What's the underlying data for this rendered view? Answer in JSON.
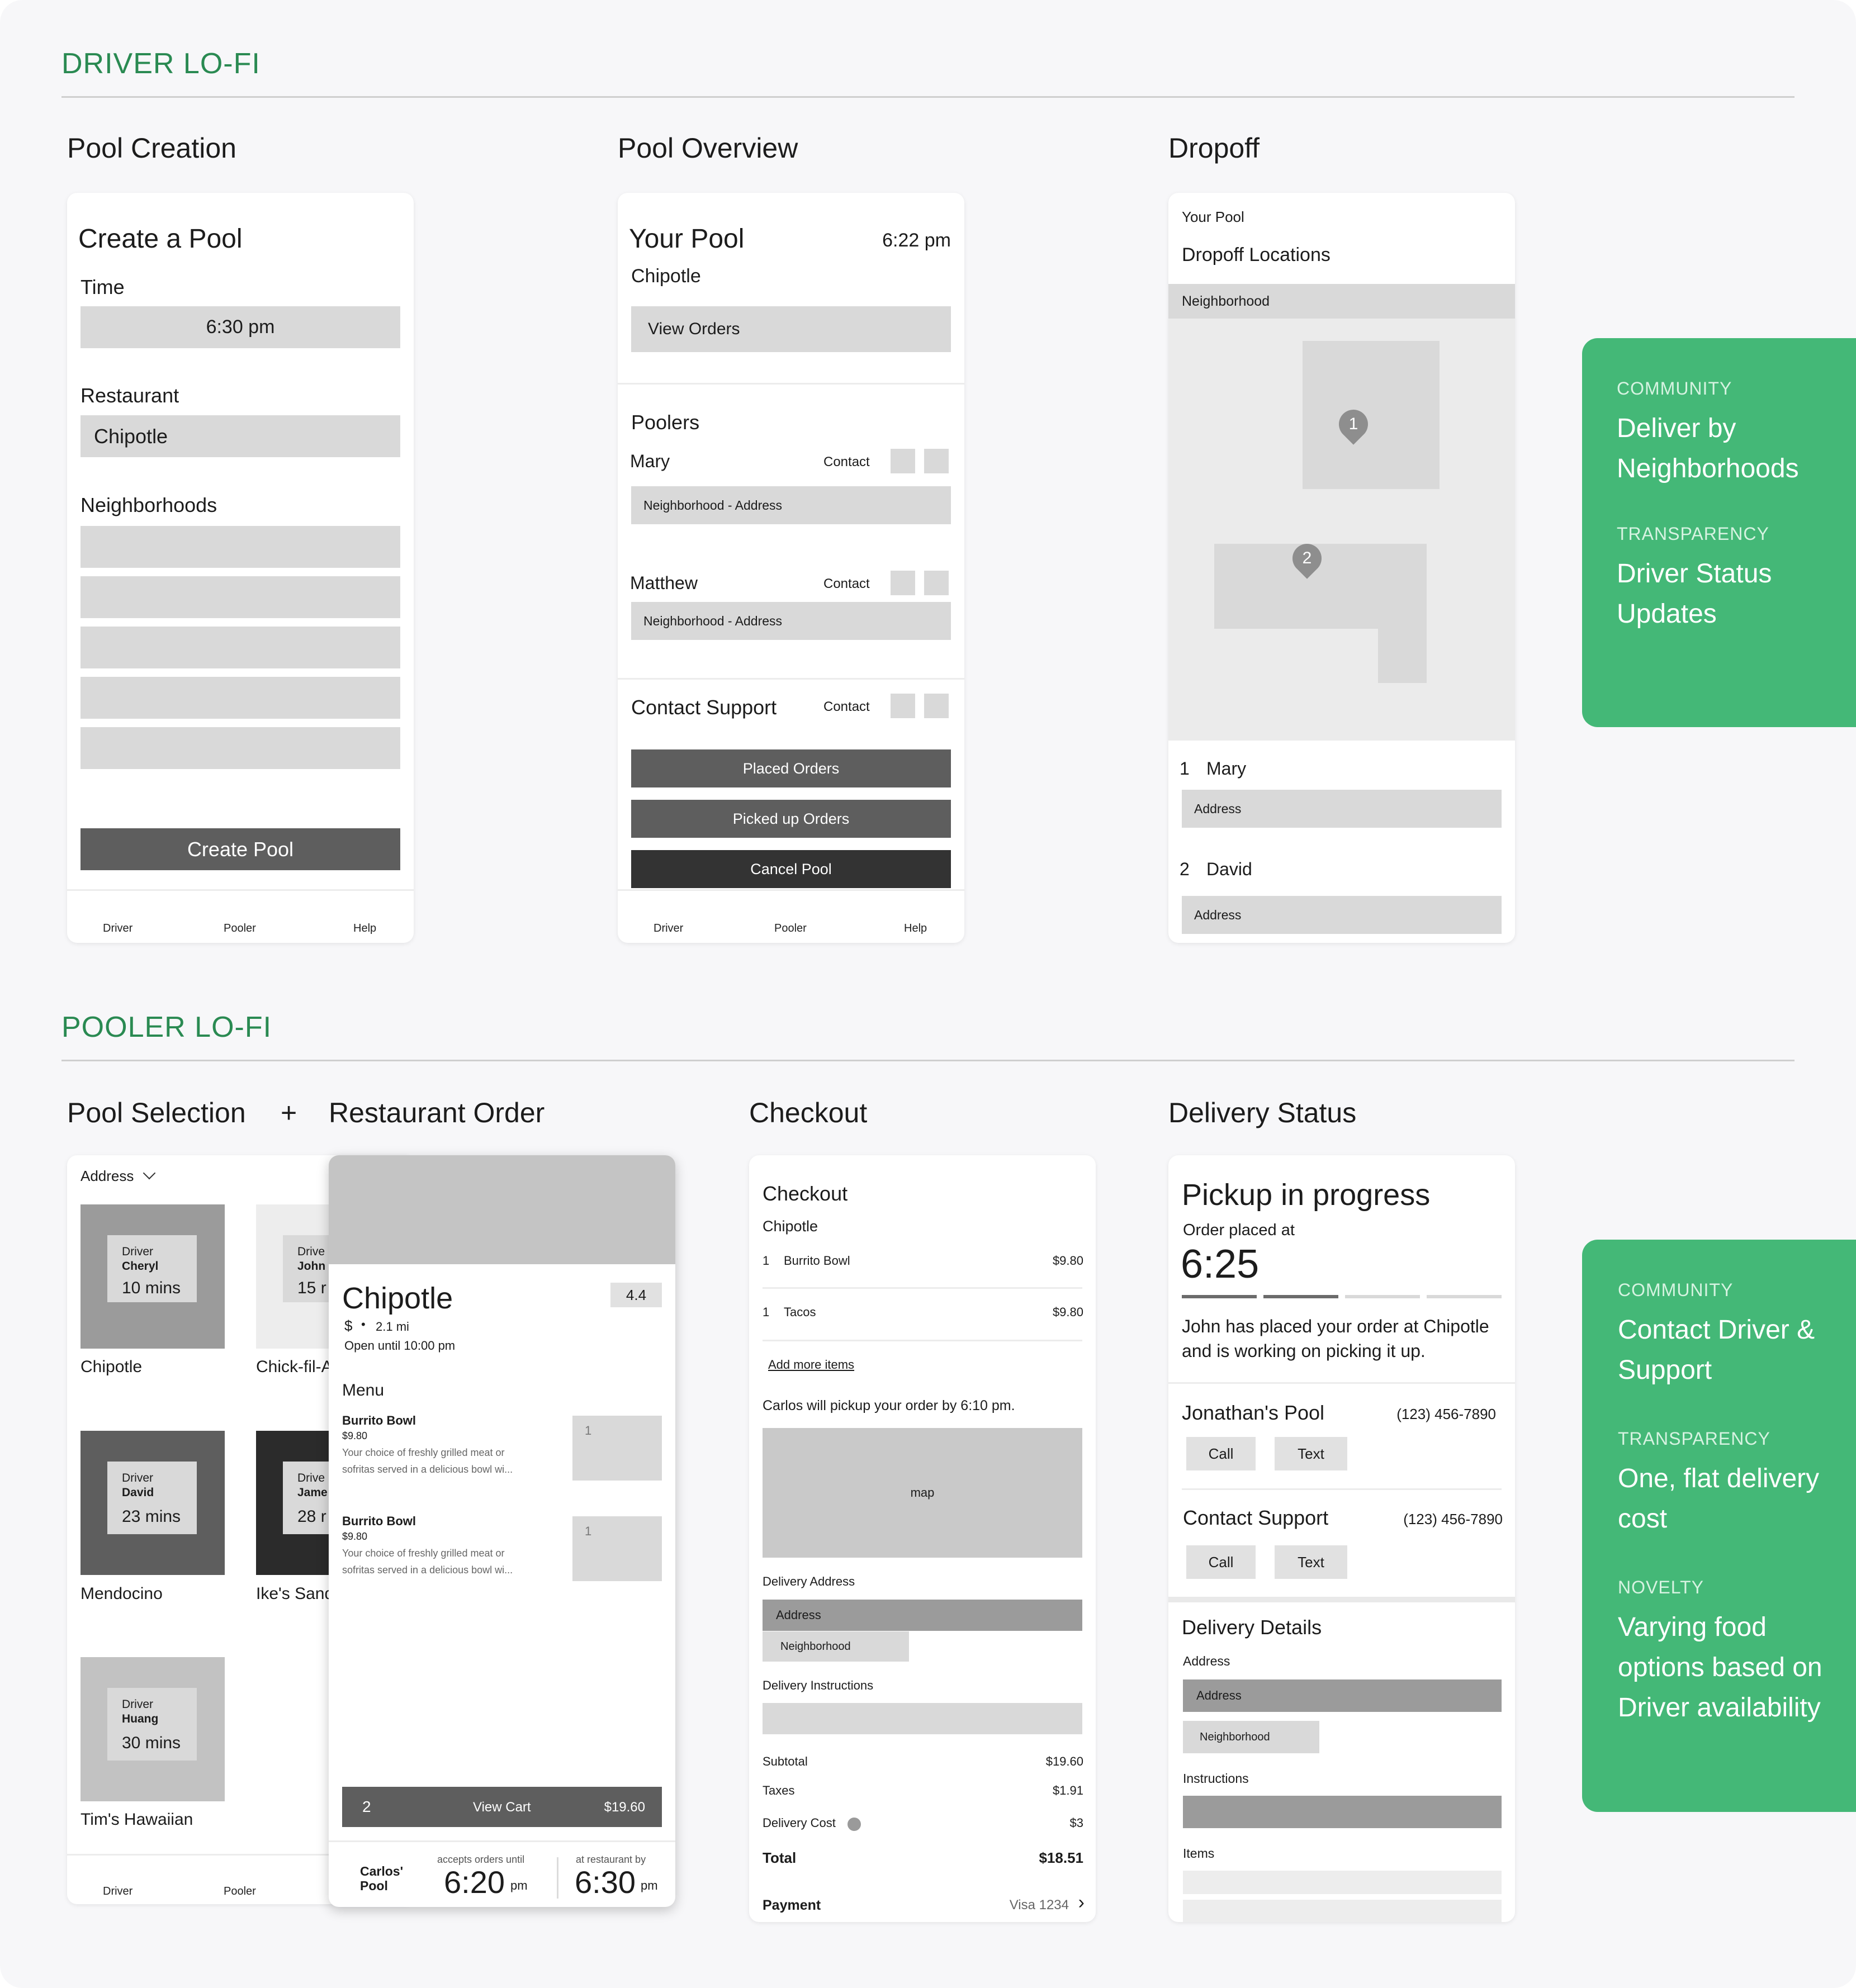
{
  "driver": {
    "section_title": "DRIVER LO-FI",
    "pool_creation": {
      "screen_title": "Pool Creation",
      "heading": "Create a Pool",
      "time_label": "Time",
      "time_value": "6:30 pm",
      "restaurant_label": "Restaurant",
      "restaurant_value": "Chipotle",
      "neighborhoods_label": "Neighborhoods",
      "create_button": "Create Pool",
      "tabs": [
        "Driver",
        "Pooler",
        "Help"
      ]
    },
    "pool_overview": {
      "screen_title": "Pool Overview",
      "heading": "Your Pool",
      "time": "6:22 pm",
      "restaurant": "Chipotle",
      "view_orders": "View Orders",
      "poolers_label": "Poolers",
      "poolers": [
        {
          "name": "Mary",
          "contact": "Contact",
          "address": "Neighborhood - Address"
        },
        {
          "name": "Matthew",
          "contact": "Contact",
          "address": "Neighborhood - Address"
        }
      ],
      "support_label": "Contact Support",
      "support_contact": "Contact",
      "placed_orders": "Placed Orders",
      "picked_up_orders": "Picked up Orders",
      "cancel_pool": "Cancel Pool",
      "tabs": [
        "Driver",
        "Pooler",
        "Help"
      ]
    },
    "dropoff": {
      "screen_title": "Dropoff",
      "small_title": "Your Pool",
      "heading": "Dropoff Locations",
      "neighborhood": "Neighborhood",
      "pins": [
        "1",
        "2"
      ],
      "stops": [
        {
          "num": "1",
          "name": "Mary",
          "address": "Address"
        },
        {
          "num": "2",
          "name": "David",
          "address": "Address"
        }
      ]
    },
    "side_panel": {
      "items": [
        {
          "label": "COMMUNITY",
          "value": "Deliver by Neighborhoods"
        },
        {
          "label": "TRANSPARENCY",
          "value": "Driver Status Updates"
        }
      ]
    }
  },
  "pooler": {
    "section_title": "POOLER LO-FI",
    "selection_title": "Pool Selection",
    "plus": "+",
    "order_title": "Restaurant Order",
    "selection": {
      "address": "Address",
      "cards": [
        {
          "driver_label": "Driver",
          "driver": "Cheryl",
          "time": "10 mins",
          "restaurant": "Chipotle"
        },
        {
          "driver_label": "Drive",
          "driver": "John",
          "time": "15 r",
          "restaurant": "Chick-fil-A"
        },
        {
          "driver_label": "Driver",
          "driver": "David",
          "time": "23 mins",
          "restaurant": "Mendocino"
        },
        {
          "driver_label": "Drive",
          "driver": "Jame",
          "time": "28 r",
          "restaurant": "Ike's Sand"
        },
        {
          "driver_label": "Driver",
          "driver": "Huang",
          "time": "30 mins",
          "restaurant": "Tim's Hawaiian"
        }
      ],
      "tabs": [
        "Driver",
        "Pooler"
      ]
    },
    "order": {
      "restaurant": "Chipotle",
      "rating": "4.4",
      "price": "$",
      "bullet": "•",
      "distance": "2.1 mi",
      "hours": "Open until 10:00 pm",
      "menu_label": "Menu",
      "items": [
        {
          "name": "Burrito Bowl",
          "price": "$9.80",
          "desc1": "Your choice of freshly grilled meat or",
          "desc2": "sofritas served in a delicious bowl wi...",
          "qty": "1"
        },
        {
          "name": "Burrito Bowl",
          "price": "$9.80",
          "desc1": "Your choice of freshly grilled meat or",
          "desc2": "sofritas served in a delicious bowl wi...",
          "qty": "1"
        }
      ],
      "cart_count": "2",
      "cart_label": "View Cart",
      "cart_total": "$19.60",
      "pool_name1": "Carlos'",
      "pool_name2": "Pool",
      "accepts_label": "accepts orders until",
      "accepts_time": "6:20",
      "accepts_suffix": "pm",
      "at_label": "at restaurant by",
      "at_time": "6:30",
      "at_suffix": "pm"
    },
    "checkout": {
      "screen_title": "Checkout",
      "heading": "Checkout",
      "restaurant": "Chipotle",
      "lines": [
        {
          "qty": "1",
          "name": "Burrito Bowl",
          "price": "$9.80"
        },
        {
          "qty": "1",
          "name": "Tacos",
          "price": "$9.80"
        }
      ],
      "add_more": "Add more items",
      "pickup_note": "Carlos will pickup your order by 6:10 pm.",
      "map_label": "map",
      "delivery_address_label": "Delivery Address",
      "address": "Address",
      "neighborhood": "Neighborhood",
      "instructions_label": "Delivery Instructions",
      "subtotal_label": "Subtotal",
      "subtotal": "$19.60",
      "taxes_label": "Taxes",
      "taxes": "$1.91",
      "delivery_cost_label": "Delivery Cost",
      "delivery_cost": "$3",
      "total_label": "Total",
      "total": "$18.51",
      "payment_label": "Payment",
      "payment": "Visa 1234",
      "chevron": "›"
    },
    "delivery_status": {
      "screen_title": "Delivery Status",
      "heading": "Pickup in progress",
      "order_placed_label": "Order placed at",
      "order_time": "6:25",
      "progress_steps": 4,
      "progress_done": 2,
      "message1": "John has placed your order at Chipotle",
      "message2": "and is working on picking it up.",
      "pool_name": "Jonathan's Pool",
      "pool_phone": "(123) 456-7890",
      "call": "Call",
      "text": "Text",
      "support_label": "Contact Support",
      "support_phone": "(123) 456-7890",
      "details_heading": "Delivery Details",
      "address_label": "Address",
      "address": "Address",
      "neighborhood": "Neighborhood",
      "instructions_label": "Instructions",
      "items_label": "Items"
    },
    "side_panel": {
      "items": [
        {
          "label": "COMMUNITY",
          "value": "Contact Driver & Support"
        },
        {
          "label": "TRANSPARENCY",
          "value": "One, flat delivery cost"
        },
        {
          "label": "NOVELTY",
          "value": "Varying food options based on Driver availability"
        }
      ]
    }
  }
}
